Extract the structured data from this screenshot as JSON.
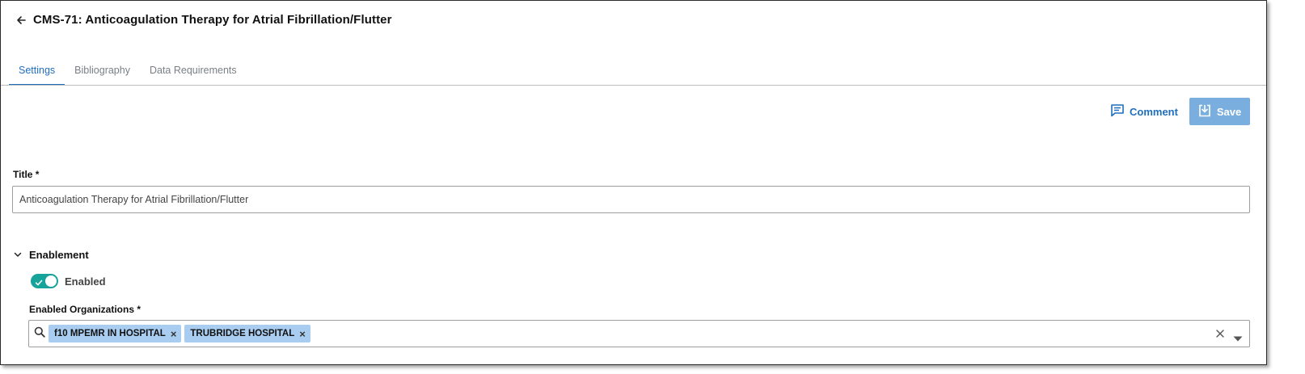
{
  "header": {
    "back_icon": "arrow-left-icon",
    "title": "CMS-71: Anticoagulation Therapy for Atrial Fibrillation/Flutter"
  },
  "tabs": [
    {
      "label": "Settings",
      "active": true
    },
    {
      "label": "Bibliography",
      "active": false
    },
    {
      "label": "Data Requirements",
      "active": false
    }
  ],
  "actions": {
    "comment_label": "Comment",
    "comment_icon": "comment-icon",
    "save_label": "Save",
    "save_icon": "save-icon"
  },
  "form": {
    "title_label": "Title *",
    "title_value": "Anticoagulation Therapy for Atrial Fibrillation/Flutter"
  },
  "enablement": {
    "section_title": "Enablement",
    "expanded": true,
    "toggle_label": "Enabled",
    "toggle_on": true,
    "orgs_label": "Enabled Organizations *",
    "orgs": [
      {
        "label": "f10 MPEMR IN HOSPITAL"
      },
      {
        "label": "TRUBRIDGE HOSPITAL"
      }
    ]
  },
  "colors": {
    "accent": "#1f6fbf",
    "save_bg": "#7aaede",
    "toggle_on": "#16a39a",
    "chip_bg": "#a9cdf0"
  }
}
